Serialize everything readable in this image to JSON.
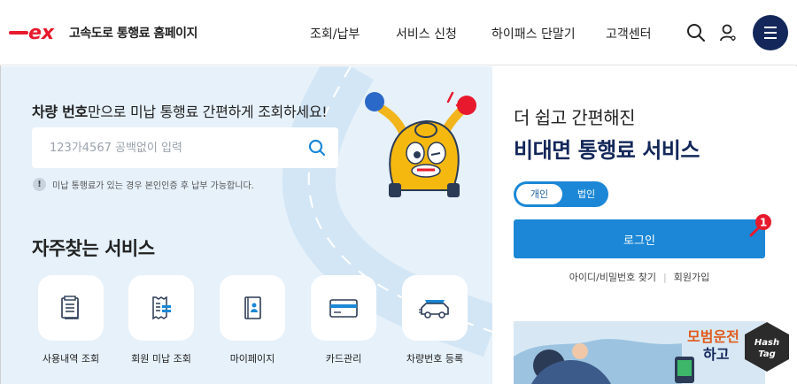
{
  "header": {
    "logo_mark": "ex",
    "logo_text": "고속도로 통행료 홈페이지",
    "nav": [
      "조회/납부",
      "서비스 신청",
      "하이패스 단말기",
      "고객센터"
    ],
    "icons": [
      "search-icon",
      "user-icon",
      "menu-icon"
    ],
    "brand_color": "#e8192c",
    "navy_color": "#13275a"
  },
  "search": {
    "title_bold": "차량 번호",
    "title_rest": "만으로 미납 통행료 간편하게 조회하세요!",
    "placeholder": "123가4567 공백없이 입력",
    "notice_mark": "!",
    "notice": "미납 통행료가 있는 경우 본인인증 후 납부 가능합니다."
  },
  "favorites": {
    "title": "자주찾는 서비스",
    "items": [
      {
        "label": "사용내역 조회",
        "icon": "document-list-icon"
      },
      {
        "label": "회원 미납 조회",
        "icon": "receipt-icon"
      },
      {
        "label": "마이페이지",
        "icon": "profile-book-icon"
      },
      {
        "label": "카드관리",
        "icon": "card-icon"
      },
      {
        "label": "차량번호 등록",
        "icon": "car-icon"
      }
    ]
  },
  "login": {
    "subtitle": "더 쉽고 간편해진",
    "title": "비대면 통행료 서비스",
    "toggle": [
      "개인",
      "법인"
    ],
    "toggle_selected": "개인",
    "login_button": "로그인",
    "badge": "1",
    "links": [
      "아이디/비밀번호 찾기",
      "회원가입"
    ],
    "accent_color": "#1b87d6"
  },
  "banner": {
    "text_line1": "모범운전",
    "text_line2": "하고"
  },
  "watermark": {
    "line1": "Hash",
    "line2": "Tag"
  }
}
